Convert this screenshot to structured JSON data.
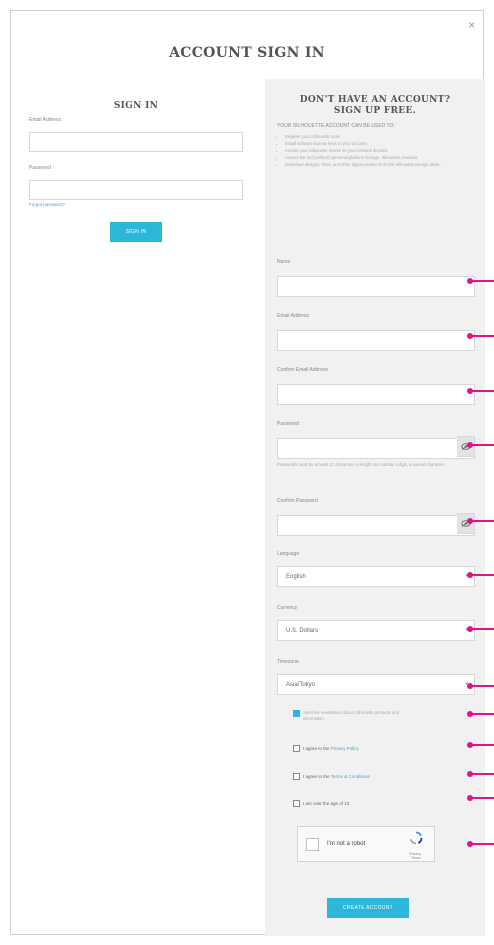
{
  "modal": {
    "close_label": "×",
    "title": "ACCOUNT SIGN IN"
  },
  "signin": {
    "heading": "SIGN IN",
    "email_label": "Email Address",
    "email_value": "",
    "password_label": "Password",
    "password_value": "",
    "forgot_label": "Forgot password?",
    "button_label": "SIGN IN"
  },
  "signup": {
    "heading_line1": "DON'T HAVE AN ACCOUNT?",
    "heading_line2": "SIGN UP FREE.",
    "intro": "YOUR SILHOUETTE ACCOUNT CAN BE USED TO:",
    "benefits": [
      "Register your Silhouette tools.",
      "Install software license keys to your account.",
      "Access your Silhouette Stores on your network devices.",
      "Access the 3rd (uniform) personal platform storage. Silhouette products.",
      "Download designs, fonts, and other digital content from the Silhouette Design Store."
    ],
    "name_label": "Name",
    "email_label": "Email Address",
    "confirm_email_label": "Confirm Email Address",
    "password_label": "Password",
    "password_hint": "Passwords must be at least 11 characters in length and contain a digit, a special character.",
    "confirm_password_label": "Confirm Password",
    "language_label": "Language",
    "language_value": "English",
    "currency_label": "Currency",
    "currency_value": "U.S. Dollars",
    "timezone_label": "Timezone",
    "timezone_value": "Asia/Tokyo",
    "newsletter_text": "Send me newsletters about Silhouette products and information.",
    "privacy_prefix": "I agree to the ",
    "privacy_link": "Privacy Policy",
    "terms_prefix": "I agree to the ",
    "terms_link": "Terms & Conditions",
    "age_text": "I am over the age of 13",
    "captcha_label": "I'm not a robot",
    "captcha_terms": "Privacy - Terms",
    "create_button": "CREATE ACCOUNT"
  },
  "colors": {
    "accent": "#2cb6d9",
    "marker": "#e01482",
    "panel": "#f1f1f1"
  },
  "icons": [
    "close-icon",
    "eye-icon",
    "chevron-down-icon",
    "recaptcha-icon"
  ]
}
